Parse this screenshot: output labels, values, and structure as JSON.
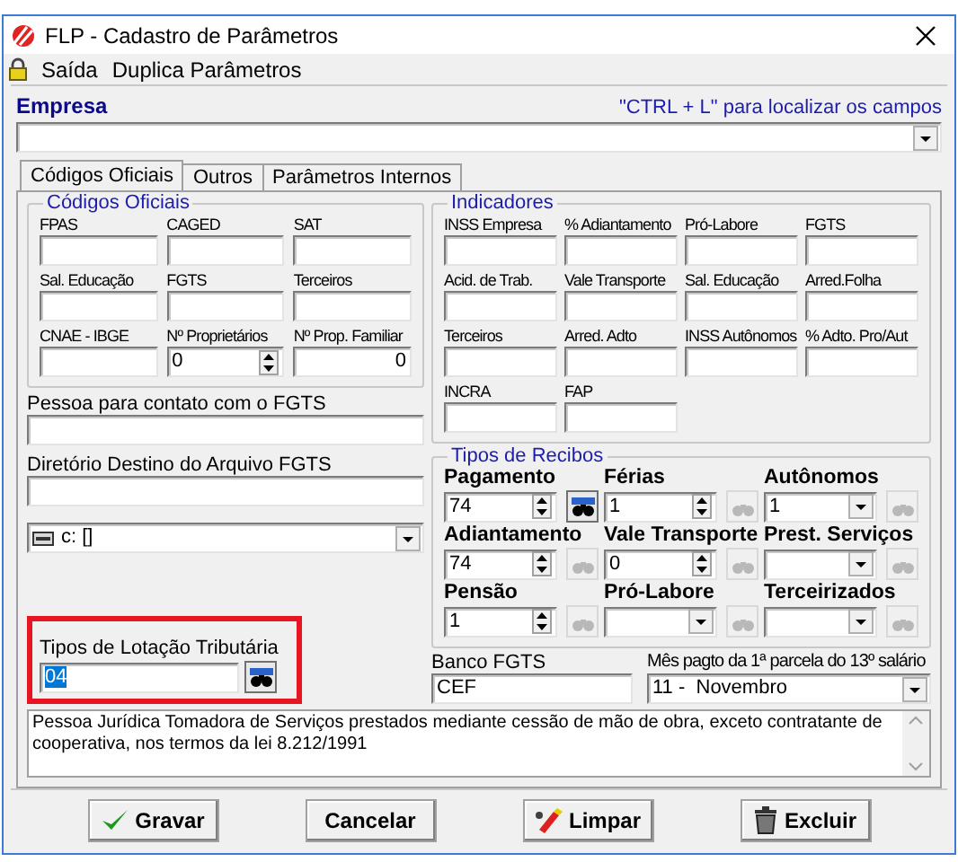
{
  "window": {
    "title": "FLP - Cadastro de Parâmetros"
  },
  "menu": [
    "Saída",
    "Duplica Parâmetros"
  ],
  "empresa": {
    "label": "Empresa",
    "hint": "\"CTRL + L\" para localizar os campos"
  },
  "tabs": [
    {
      "label": "Códigos Oficiais",
      "selected": true
    },
    {
      "label": "Outros",
      "selected": false
    },
    {
      "label": "Parâmetros Internos",
      "selected": false
    }
  ],
  "codigos_oficiais": {
    "title": "Códigos Oficiais",
    "fields": [
      {
        "label": "FPAS",
        "kind": "text"
      },
      {
        "label": "CAGED",
        "kind": "text"
      },
      {
        "label": "SAT",
        "kind": "text"
      },
      {
        "label": "Sal. Educação",
        "kind": "text"
      },
      {
        "label": "FGTS",
        "kind": "text"
      },
      {
        "label": "Terceiros",
        "kind": "text"
      },
      {
        "label": "CNAE - IBGE",
        "kind": "text"
      },
      {
        "label": "Nº Proprietários",
        "kind": "spin",
        "value": "0"
      },
      {
        "label": "Nº Prop. Familiar",
        "kind": "number",
        "value": "0"
      }
    ]
  },
  "contato": {
    "label": "Pessoa para contato com o FGTS"
  },
  "diretorio": {
    "label": "Diretório Destino do Arquivo FGTS"
  },
  "drive": {
    "value": "c: []"
  },
  "lotacao": {
    "label": "Tipos de Lotação Tributária",
    "value": "04",
    "highlighted": true,
    "text_selected": true
  },
  "indicadores": {
    "title": "Indicadores",
    "fields": [
      {
        "label": "INSS Empresa"
      },
      {
        "label": "% Adiantamento"
      },
      {
        "label": "Pró-Labore"
      },
      {
        "label": "FGTS"
      },
      {
        "label": "Acid. de Trab."
      },
      {
        "label": "Vale Transporte"
      },
      {
        "label": "Sal. Educação"
      },
      {
        "label": "Arred.Folha"
      },
      {
        "label": "Terceiros"
      },
      {
        "label": "Arred. Adto"
      },
      {
        "label": "INSS Autônomos"
      },
      {
        "label": "% Adto. Pro/Aut"
      },
      {
        "label": "INCRA"
      },
      {
        "label": "FAP"
      }
    ]
  },
  "tipos_recibos": {
    "title": "Tipos de Recibos",
    "items": [
      {
        "label": "Pagamento",
        "kind": "spin",
        "value": "74",
        "search_enabled": true
      },
      {
        "label": "Férias",
        "kind": "spin",
        "value": "1",
        "search_enabled": false
      },
      {
        "label": "Autônomos",
        "kind": "combo",
        "value": "1",
        "search_enabled": false
      },
      {
        "label": "Adiantamento",
        "kind": "spin",
        "value": "74",
        "search_enabled": false
      },
      {
        "label": "Vale Transporte",
        "kind": "spin",
        "value": "0",
        "search_enabled": false
      },
      {
        "label": "Prest. Serviços",
        "kind": "combo",
        "search_enabled": false
      },
      {
        "label": "Pensão",
        "kind": "spin",
        "value": "1",
        "search_enabled": false
      },
      {
        "label": "Pró-Labore",
        "kind": "combo",
        "search_enabled": false
      },
      {
        "label": "Terceirizados",
        "kind": "combo",
        "search_enabled": false
      }
    ]
  },
  "banco": {
    "label": "Banco FGTS",
    "value": "CEF"
  },
  "mes": {
    "label": "Mês pagto da 1ª parcela do 13º salário",
    "value": "11 -  Novembro"
  },
  "descricao": "Pessoa Jurídica Tomadora de Serviços prestados mediante cessão de mão de obra, exceto contratante de cooperativa, nos termos da lei 8.212/1991",
  "buttons": [
    {
      "label": "Gravar",
      "kind": "save"
    },
    {
      "label": "Cancelar",
      "kind": "cancel"
    },
    {
      "label": "Limpar",
      "kind": "clear"
    },
    {
      "label": "Excluir",
      "kind": "delete"
    }
  ]
}
